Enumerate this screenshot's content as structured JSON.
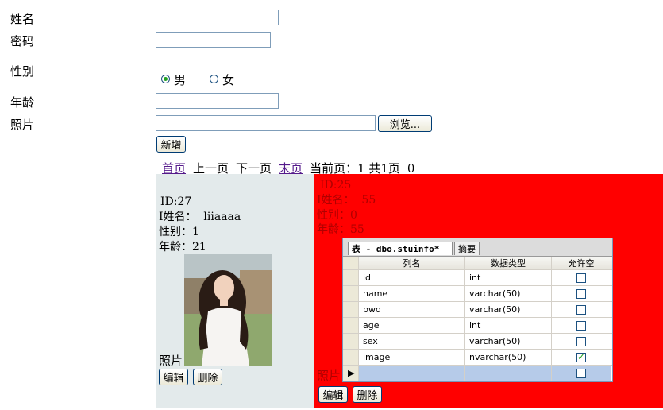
{
  "form": {
    "name_label": "姓名",
    "pwd_label": "密码",
    "sex_label": "性别",
    "sex_male": "男",
    "sex_female": "女",
    "age_label": "年龄",
    "photo_label": "照片",
    "browse": "浏览...",
    "add": "新增"
  },
  "pager": {
    "first": "首页",
    "prev": "上一页",
    "next": "下一页",
    "last": "末页",
    "current": "当前页：1 共1页",
    "count": "0"
  },
  "cards": [
    {
      "id": "ID:27",
      "name": "I姓名：  liiaaaa",
      "sex": "性别：1",
      "age": "年龄：21",
      "photo": "照片",
      "edit": "编辑",
      "delete": "删除"
    },
    {
      "id": "ID:25",
      "name": "I姓名：  55",
      "sex": "性别：0",
      "age": "年龄：55",
      "photo": "照片",
      "edit": "编辑",
      "delete": "删除"
    }
  ],
  "designer": {
    "tab1": "表 - dbo.stuinfo*",
    "tab2": "摘要",
    "headers": [
      "列名",
      "数据类型",
      "允许空"
    ],
    "rows": [
      {
        "name": "id",
        "type": "int",
        "nullable": false
      },
      {
        "name": "name",
        "type": "varchar(50)",
        "nullable": false
      },
      {
        "name": "pwd",
        "type": "varchar(50)",
        "nullable": false
      },
      {
        "name": "age",
        "type": "int",
        "nullable": false
      },
      {
        "name": "sex",
        "type": "varchar(50)",
        "nullable": false
      },
      {
        "name": "image",
        "type": "nvarchar(50)",
        "nullable": true
      }
    ]
  },
  "colors": {
    "card1_bg": "#e3eaeb",
    "card2_bg": "#ff0000"
  }
}
